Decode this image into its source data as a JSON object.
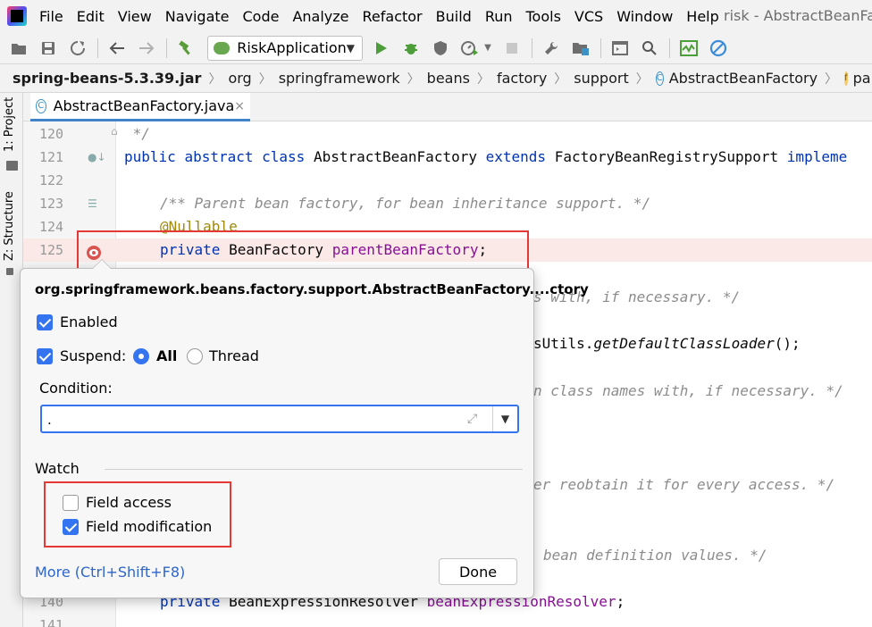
{
  "menubar": {
    "items": [
      "File",
      "Edit",
      "View",
      "Navigate",
      "Code",
      "Analyze",
      "Refactor",
      "Build",
      "Run",
      "Tools",
      "VCS",
      "Window",
      "Help"
    ],
    "title": "risk - AbstractBeanFact"
  },
  "toolbar": {
    "run_config": "RiskApplication"
  },
  "breadcrumb": {
    "jar": "spring-beans-5.3.39.jar",
    "org": "org",
    "springframework": "springframework",
    "beans": "beans",
    "factory": "factory",
    "support": "support",
    "class_name": "AbstractBeanFactory",
    "field_name": "parentBeanFactory",
    "class_icon_glyph": "C",
    "field_icon_glyph": "f"
  },
  "leftstrip": {
    "project_tab": "1: Project",
    "structure_tab": "Z: Structure"
  },
  "editor_tab": {
    "filename": "AbstractBeanFactory.java",
    "icon_glyph": "C",
    "close_glyph": "×"
  },
  "editor": {
    "line_numbers": {
      "l120": "120",
      "l121": "121",
      "l122": "122",
      "l123": "123",
      "l124": "124",
      "l125": "125",
      "l140": "140",
      "l141": "141"
    },
    "code": {
      "l120": " */",
      "l121_kw1": "public",
      "l121_kw2": "abstract",
      "l121_kw3": "class",
      "l121_name": "AbstractBeanFactory",
      "l121_kw4": "extends",
      "l121_super": "FactoryBeanRegistrySupport",
      "l121_kw5": "impleme",
      "l123_comment": "/** Parent bean factory, for bean inheritance support. */",
      "l124_annotation": "@Nullable",
      "l125_kw": "private",
      "l125_type": "BeanFactory",
      "l125_field": "parentBeanFactory",
      "l125_semi": ";",
      "frag1": "s with, if necessary. */",
      "frag2_call": "getDefaultClassLoader",
      "frag2_pre": "sUtils.",
      "frag2_post": "();",
      "frag3": "n class names with, if necessary. */",
      "frag4": "er reobtain it for every access. */",
      "frag5": "bean definition values. */",
      "l140_kw": "private",
      "l140_type": "BeanExpressionResolver",
      "l140_field": "beanExpressionResolver",
      "l140_semi": ";"
    }
  },
  "breakpoint_popup": {
    "title": "org.springframework.beans.factory.support.AbstractBeanFactory....ctory",
    "enabled_label": "Enabled",
    "enabled_checked": true,
    "suspend_label": "Suspend:",
    "suspend_checked": true,
    "suspend_all_label": "All",
    "suspend_thread_label": "Thread",
    "suspend_selected": "All",
    "condition_label": "Condition:",
    "condition_value": ".",
    "watch_label": "Watch",
    "field_access_label": "Field access",
    "field_access_checked": false,
    "field_modification_label": "Field modification",
    "field_modification_checked": true,
    "more_link": "More (Ctrl+Shift+F8)",
    "done_button": "Done"
  },
  "colors": {
    "accent": "#3574f0",
    "highlight_box": "#e53935",
    "keyword": "#0033b3",
    "field": "#871094",
    "annotation": "#9e880d",
    "comment": "#8c8c8c"
  }
}
